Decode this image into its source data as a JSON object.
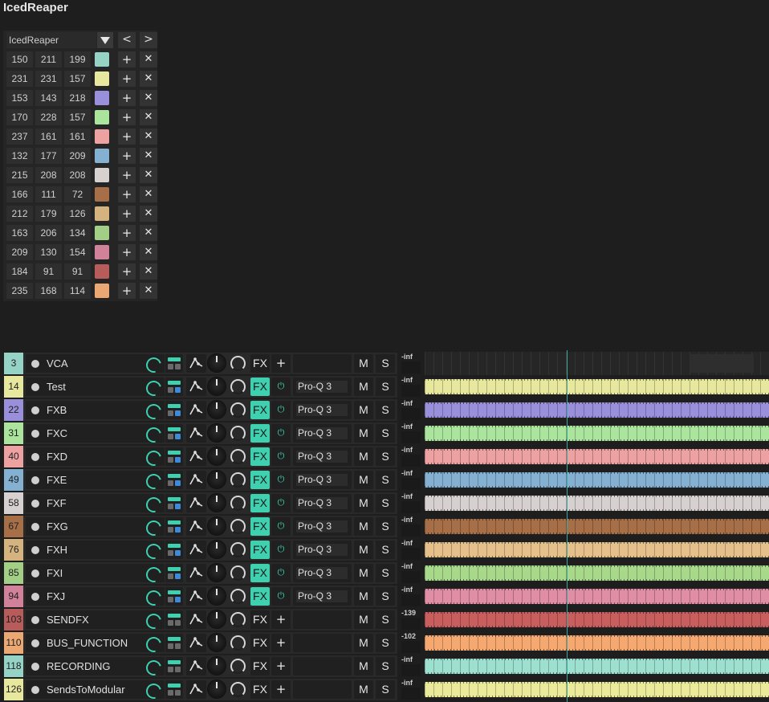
{
  "app": {
    "title": "IcedReaper"
  },
  "palette": {
    "theme_name": "IcedReaper",
    "prev_label": "<",
    "next_label": ">",
    "add_label": "+",
    "remove_label": "✕",
    "colors": [
      {
        "r": "150",
        "g": "211",
        "b": "199",
        "hex": "#96d3c7"
      },
      {
        "r": "231",
        "g": "231",
        "b": "157",
        "hex": "#e7e79d"
      },
      {
        "r": "153",
        "g": "143",
        "b": "218",
        "hex": "#998fda"
      },
      {
        "r": "170",
        "g": "228",
        "b": "157",
        "hex": "#aae49d"
      },
      {
        "r": "237",
        "g": "161",
        "b": "161",
        "hex": "#eda1a1"
      },
      {
        "r": "132",
        "g": "177",
        "b": "209",
        "hex": "#84b1d1"
      },
      {
        "r": "215",
        "g": "208",
        "b": "208",
        "hex": "#d7d0d0"
      },
      {
        "r": "166",
        "g": "111",
        "b": "72",
        "hex": "#a66f48"
      },
      {
        "r": "212",
        "g": "179",
        "b": "126",
        "hex": "#d4b37e"
      },
      {
        "r": "163",
        "g": "206",
        "b": "134",
        "hex": "#a3ce86"
      },
      {
        "r": "209",
        "g": "130",
        "b": "154",
        "hex": "#d1829a"
      },
      {
        "r": "184",
        "g": "91",
        "b": "91",
        "hex": "#b85b5b"
      },
      {
        "r": "235",
        "g": "168",
        "b": "114",
        "hex": "#eba872"
      }
    ]
  },
  "tracks": [
    {
      "num": "3",
      "name": "VCA",
      "color": "#96d3c7",
      "fx_active": false,
      "plugin": "",
      "meter": "-inf",
      "route_on": false,
      "lane": "empty"
    },
    {
      "num": "14",
      "name": "Test",
      "color": "#e7e79d",
      "fx_active": true,
      "plugin": "Pro-Q 3",
      "meter": "-inf",
      "route_on": true,
      "lane": "#e7e79d"
    },
    {
      "num": "22",
      "name": "FXB",
      "color": "#998fda",
      "fx_active": true,
      "plugin": "Pro-Q 3",
      "meter": "-inf",
      "route_on": true,
      "lane": "#998fda"
    },
    {
      "num": "31",
      "name": "FXC",
      "color": "#aae49d",
      "fx_active": true,
      "plugin": "Pro-Q 3",
      "meter": "-inf",
      "route_on": true,
      "lane": "#aae49d"
    },
    {
      "num": "40",
      "name": "FXD",
      "color": "#eda1a1",
      "fx_active": true,
      "plugin": "Pro-Q 3",
      "meter": "-inf",
      "route_on": true,
      "lane": "#eda1a1"
    },
    {
      "num": "49",
      "name": "FXE",
      "color": "#84b1d1",
      "fx_active": true,
      "plugin": "Pro-Q 3",
      "meter": "-inf",
      "route_on": true,
      "lane": "#84b1d1"
    },
    {
      "num": "58",
      "name": "FXF",
      "color": "#d7d0d0",
      "fx_active": true,
      "plugin": "Pro-Q 3",
      "meter": "-inf",
      "route_on": true,
      "lane": "#d7d0d0"
    },
    {
      "num": "67",
      "name": "FXG",
      "color": "#a66f48",
      "fx_active": true,
      "plugin": "Pro-Q 3",
      "meter": "-inf",
      "route_on": true,
      "lane": "#a66f48"
    },
    {
      "num": "76",
      "name": "FXH",
      "color": "#d4b37e",
      "fx_active": true,
      "plugin": "Pro-Q 3",
      "meter": "-inf",
      "route_on": true,
      "lane": "#e6c08a"
    },
    {
      "num": "85",
      "name": "FXI",
      "color": "#a3ce86",
      "fx_active": true,
      "plugin": "Pro-Q 3",
      "meter": "-inf",
      "route_on": true,
      "lane": "#a8d88a"
    },
    {
      "num": "94",
      "name": "FXJ",
      "color": "#d1829a",
      "fx_active": true,
      "plugin": "Pro-Q 3",
      "meter": "-inf",
      "route_on": true,
      "lane": "#e08ea6"
    },
    {
      "num": "103",
      "name": "SENDFX",
      "color": "#b85b5b",
      "fx_active": false,
      "plugin": "",
      "meter": "-139",
      "route_on": false,
      "lane": "#c85e5e"
    },
    {
      "num": "110",
      "name": "BUS_FUNCTION",
      "color": "#eba872",
      "fx_active": false,
      "plugin": "",
      "meter": "-102",
      "route_on": false,
      "lane": "#f5a870"
    },
    {
      "num": "118",
      "name": "RECORDING",
      "color": "#96d3c7",
      "fx_active": false,
      "plugin": "",
      "meter": "-inf",
      "route_on": false,
      "lane": "#9ee0d0"
    },
    {
      "num": "126",
      "name": "SendsToModular",
      "color": "#e7e79d",
      "fx_active": false,
      "plugin": "",
      "meter": "-inf",
      "route_on": false,
      "lane": "#eaea9a"
    }
  ],
  "track_controls": {
    "fx_label": "FX",
    "add_label": "+",
    "power_label": "⏻",
    "mute_label": "M",
    "solo_label": "S"
  }
}
